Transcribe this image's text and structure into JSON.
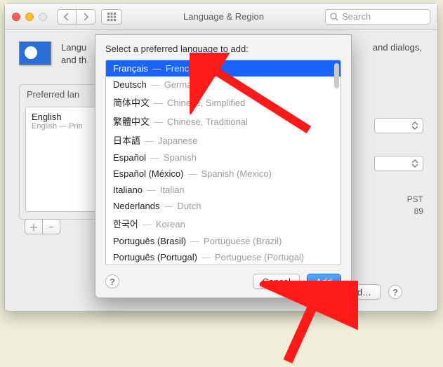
{
  "window": {
    "title": "Language & Region",
    "search_placeholder": "Search"
  },
  "intro": {
    "line1": "Langu",
    "line1_suffix": "and dialogs,",
    "line2": "and th"
  },
  "preferred_box": {
    "header": "Preferred lan",
    "current": "English",
    "subtitle": "English — Prin"
  },
  "right": {
    "status1": "PST",
    "status2": "89"
  },
  "advanced_label": "vanced…",
  "sheet": {
    "prompt": "Select a preferred language to add:",
    "cancel": "Cancel",
    "add": "Add",
    "languages": [
      {
        "native": "Français",
        "english": "French",
        "selected": true
      },
      {
        "native": "Deutsch",
        "english": "German"
      },
      {
        "native": "简体中文",
        "english": "Chinese, Simplified"
      },
      {
        "native": "繁體中文",
        "english": "Chinese, Traditional"
      },
      {
        "native": "日本語",
        "english": "Japanese"
      },
      {
        "native": "Español",
        "english": "Spanish"
      },
      {
        "native": "Español (México)",
        "english": "Spanish (Mexico)"
      },
      {
        "native": "Italiano",
        "english": "Italian"
      },
      {
        "native": "Nederlands",
        "english": "Dutch"
      },
      {
        "native": "한국어",
        "english": "Korean"
      },
      {
        "native": "Português (Brasil)",
        "english": "Portuguese (Brazil)"
      },
      {
        "native": "Português (Portugal)",
        "english": "Portuguese (Portugal)"
      }
    ]
  }
}
